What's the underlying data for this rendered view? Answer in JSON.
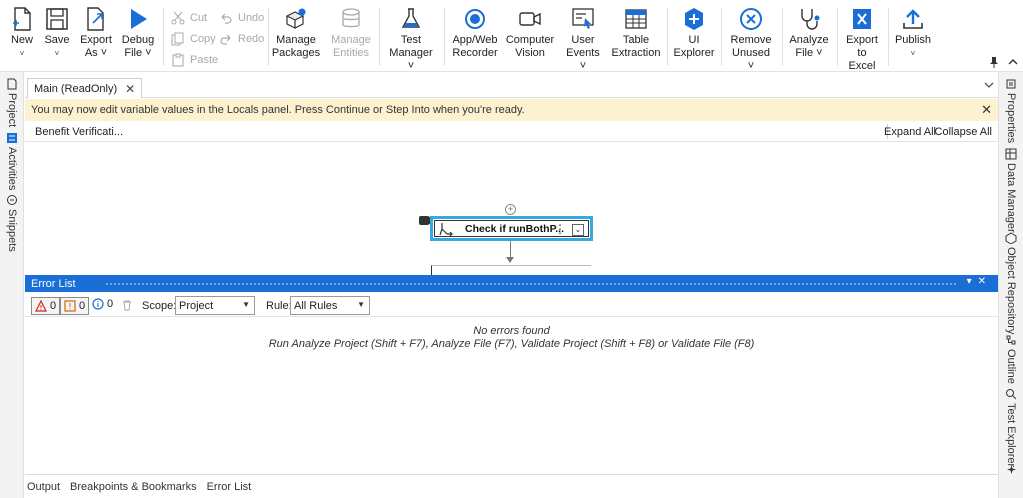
{
  "ribbon": {
    "new": {
      "l1": "New",
      "l2": "˅"
    },
    "save": {
      "l1": "Save",
      "l2": "˅"
    },
    "export_as": {
      "l1": "Export",
      "l2": "As ˅"
    },
    "debug_file": {
      "l1": "Debug",
      "l2": "File ˅"
    },
    "cut": "Cut",
    "copy": "Copy",
    "paste": "Paste",
    "undo": "Undo",
    "redo": "Redo",
    "manage_packages": {
      "l1": "Manage",
      "l2": "Packages"
    },
    "manage_entities": {
      "l1": "Manage",
      "l2": "Entities"
    },
    "test_manager": {
      "l1": "Test",
      "l2": "Manager ˅"
    },
    "app_web_recorder": {
      "l1": "App/Web",
      "l2": "Recorder"
    },
    "computer_vision": {
      "l1": "Computer",
      "l2": "Vision"
    },
    "user_events": {
      "l1": "User",
      "l2": "Events ˅"
    },
    "table_extraction": {
      "l1": "Table",
      "l2": "Extraction"
    },
    "ui_explorer": {
      "l1": "UI",
      "l2": "Explorer"
    },
    "remove_unused": {
      "l1": "Remove",
      "l2": "Unused ˅"
    },
    "analyze_file": {
      "l1": "Analyze",
      "l2": "File ˅"
    },
    "export_to_excel": {
      "l1": "Export",
      "l2": "to Excel"
    },
    "publish": {
      "l1": "Publish",
      "l2": "˅"
    }
  },
  "left_panels": [
    "Project",
    "Activities",
    "Snippets"
  ],
  "right_panels": [
    "Properties",
    "Data Manager",
    "Object Repository",
    "Outline",
    "Test Explorer"
  ],
  "document_tab": {
    "label": "Main (ReadOnly)",
    "close": "✕"
  },
  "info_bar": {
    "message": "You may now edit variable values in the Locals panel. Press Continue or Step Into when you're ready.",
    "close": "✕"
  },
  "breadcrumb": {
    "item": "Benefit Verificati...",
    "expand_all": "Expand All",
    "collapse_all": "Collapse All"
  },
  "designer": {
    "activity_title": "Check if runBothP...",
    "plus": "+"
  },
  "error_list": {
    "title": "Error List",
    "errors_count": "0",
    "warnings_count": "0",
    "info_count": "0",
    "scope_label": "Scope:",
    "scope_value": "Project",
    "rule_label": "Rule:",
    "rule_value": "All Rules",
    "empty_line1": "No errors found",
    "empty_line2": "Run Analyze Project (Shift + F7), Analyze File (F7), Validate Project (Shift + F8) or Validate File (F8)"
  },
  "bottom_tabs": [
    "Output",
    "Breakpoints & Bookmarks",
    "Error List"
  ],
  "colors": {
    "accent": "#1a6fd6",
    "info_bar": "#fdf2cf",
    "selection": "#3aa8e0"
  }
}
